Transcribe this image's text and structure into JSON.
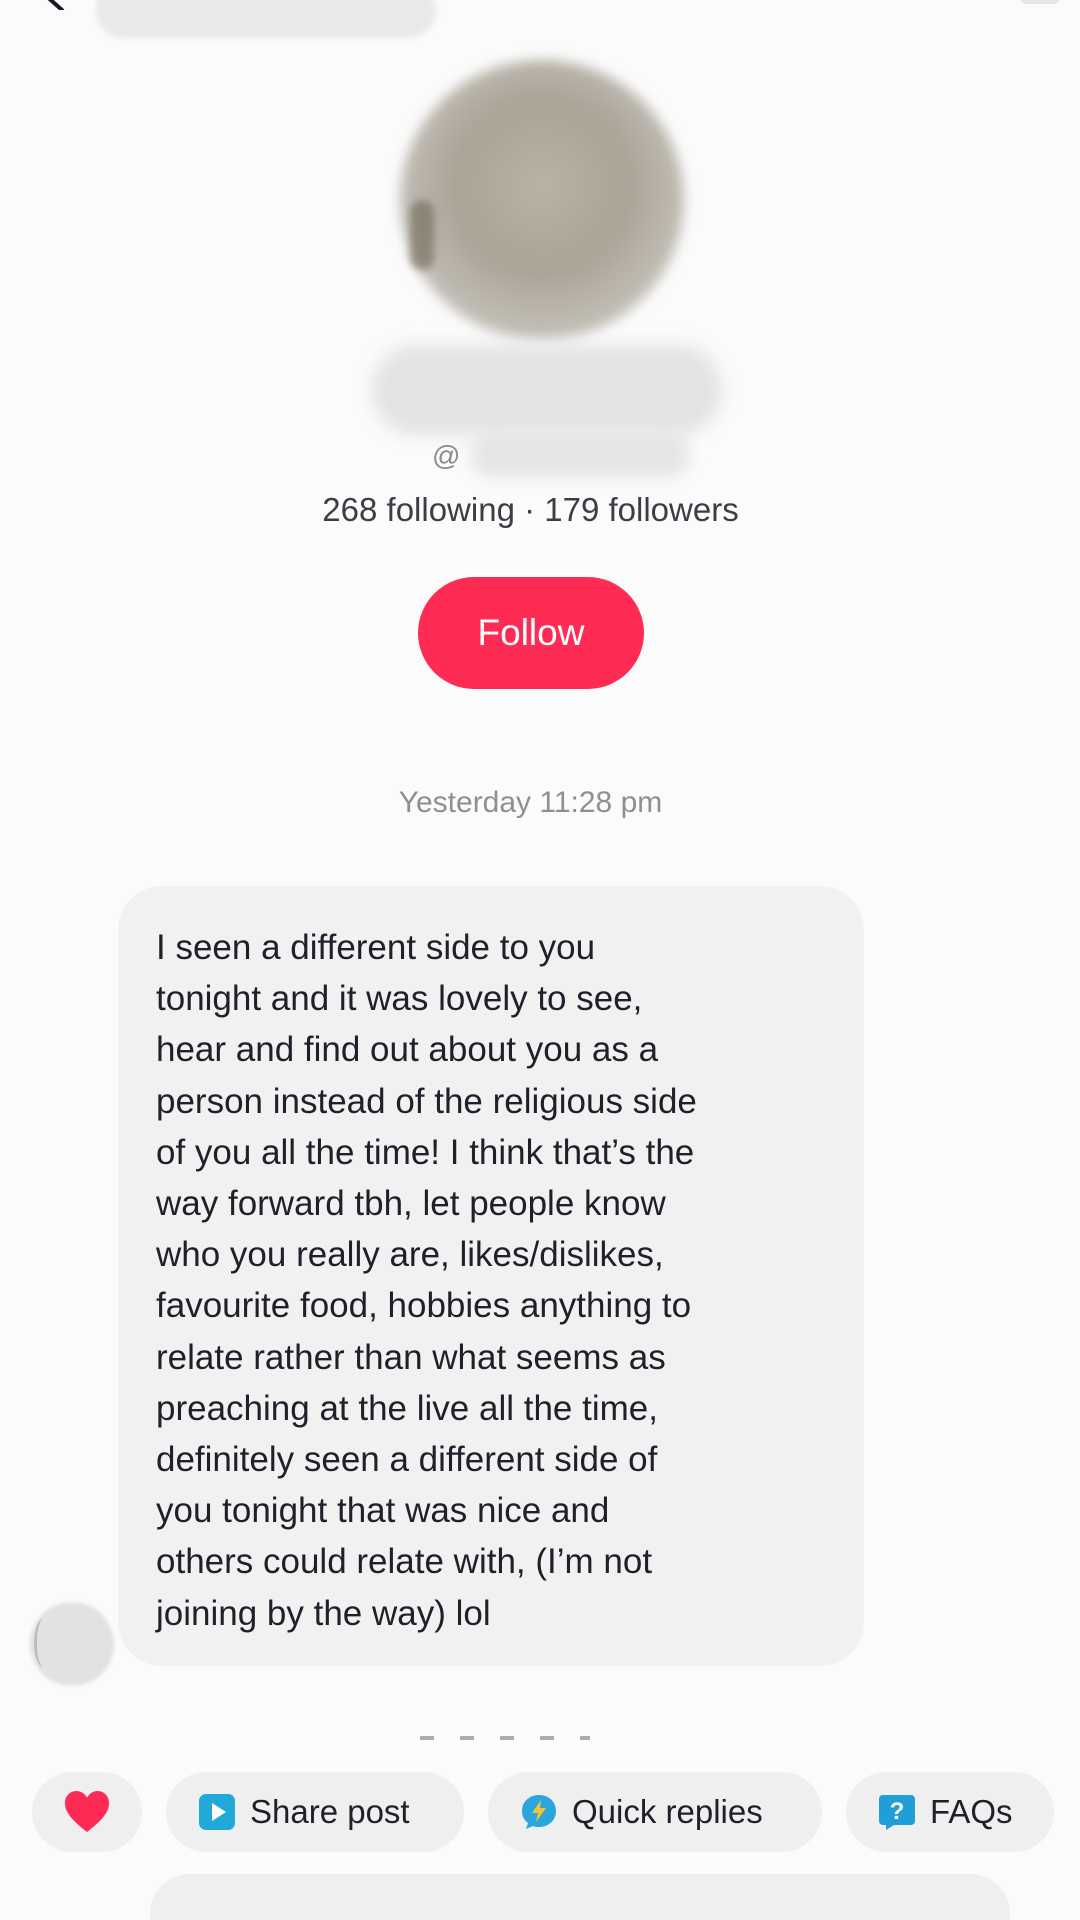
{
  "header": {
    "back_icon": "chevron-left-icon"
  },
  "profile": {
    "handle_prefix": "@",
    "stats": "268 following · 179 followers",
    "follow_label": "Follow"
  },
  "conversation": {
    "timestamp": "Yesterday 11:28 pm",
    "message": "I seen a different side to you\ntonight and it was lovely to see,\nhear and find out about you as a\nperson instead of the religious side\nof you all the time! I think that’s the\nway forward tbh, let people know\nwho you really are, likes/dislikes,\nfavourite food, hobbies anything to\nrelate rather than what seems as\npreaching at the live all the time,\ndefinitely seen a different side of\nyou tonight that was nice and\nothers could relate with, (I’m not\njoining by the way) lol"
  },
  "quick_actions": {
    "heart_icon": "heart-icon",
    "share_label": "Share post",
    "quick_replies_label": "Quick replies",
    "faqs_label": "FAQs"
  },
  "colors": {
    "follow_button": "#fe2c55",
    "heart": "#fe2c55",
    "share_icon": "#20a9d8",
    "quick_icon": "#2aa6dc",
    "faq_icon": "#1f9fd6"
  }
}
